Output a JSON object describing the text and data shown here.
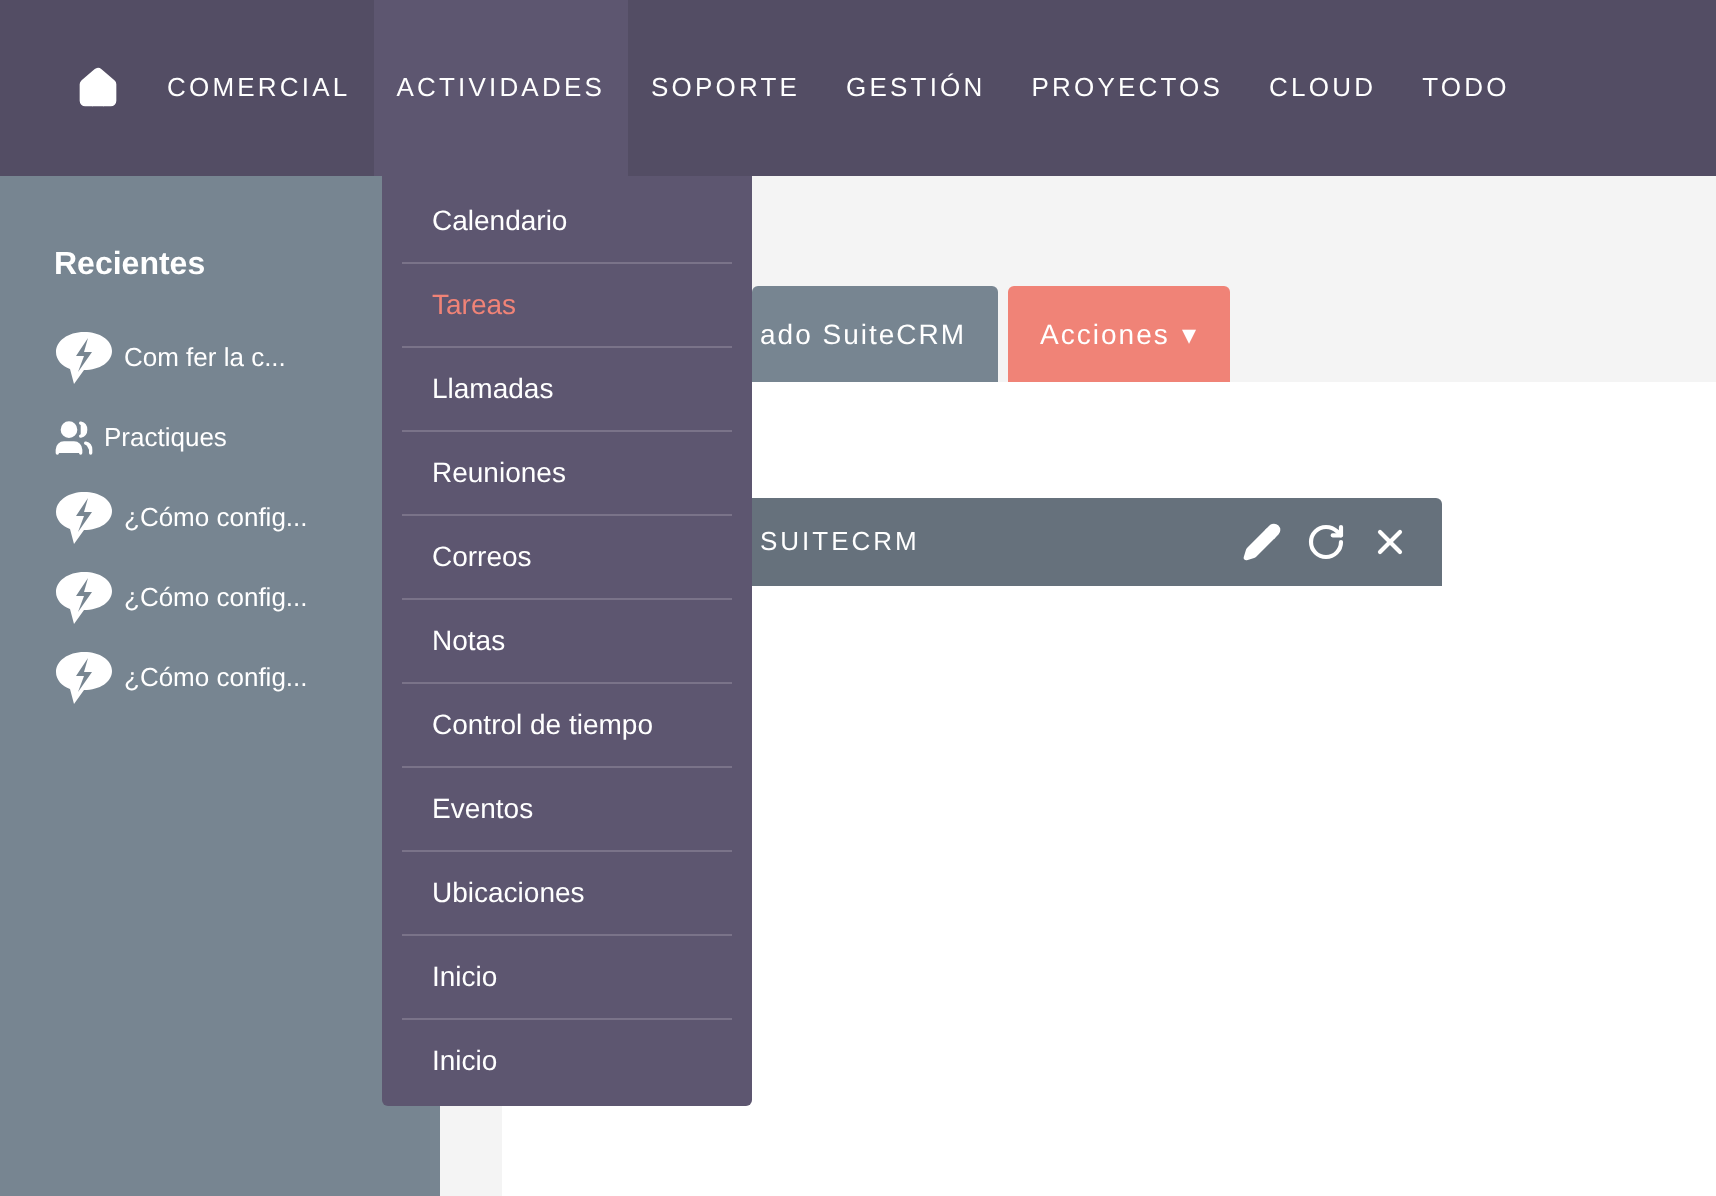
{
  "nav": {
    "items": [
      {
        "label": "COMERCIAL",
        "selected": false
      },
      {
        "label": "ACTIVIDADES",
        "selected": true
      },
      {
        "label": "SOPORTE",
        "selected": false
      },
      {
        "label": "GESTIÓN",
        "selected": false
      },
      {
        "label": "PROYECTOS",
        "selected": false
      },
      {
        "label": "CLOUD",
        "selected": false
      },
      {
        "label": "TODO",
        "selected": false
      }
    ]
  },
  "sidebar": {
    "title": "Recientes",
    "items": [
      {
        "kind": "case",
        "label": "Com fer la c..."
      },
      {
        "kind": "group",
        "label": "Practiques"
      },
      {
        "kind": "case",
        "label": "¿Cómo config..."
      },
      {
        "kind": "case",
        "label": "¿Cómo config..."
      },
      {
        "kind": "case",
        "label": "¿Cómo config..."
      }
    ]
  },
  "dropdown": {
    "items": [
      {
        "label": "Calendario",
        "selected": false
      },
      {
        "label": "Tareas",
        "selected": true
      },
      {
        "label": "Llamadas",
        "selected": false
      },
      {
        "label": "Reuniones",
        "selected": false
      },
      {
        "label": "Correos",
        "selected": false
      },
      {
        "label": "Notas",
        "selected": false
      },
      {
        "label": "Control de tiempo",
        "selected": false
      },
      {
        "label": "Eventos",
        "selected": false
      },
      {
        "label": "Ubicaciones",
        "selected": false
      },
      {
        "label": "Inicio",
        "selected": false
      },
      {
        "label": "Inicio",
        "selected": false
      }
    ]
  },
  "tabs": [
    {
      "label": "ado SuiteCRM"
    },
    {
      "label": "Acciones",
      "caret": "▾"
    }
  ],
  "dashlet": {
    "title": "SUITECRM"
  }
}
